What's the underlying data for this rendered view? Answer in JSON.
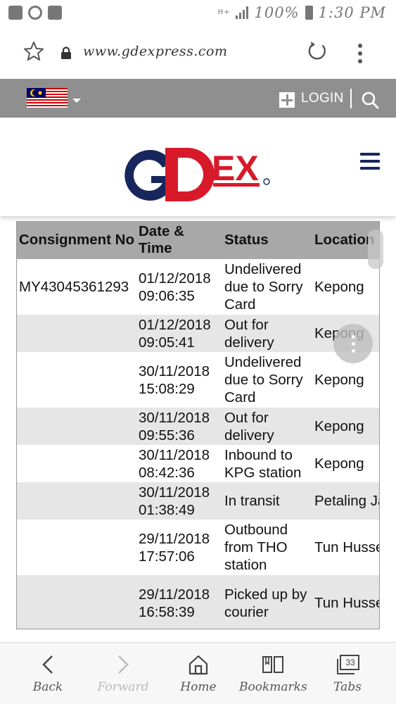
{
  "status_bar": {
    "network": "H+",
    "battery": "100%",
    "time": "1:30 PM"
  },
  "browser": {
    "url": "www.gdexpress.com"
  },
  "site_nav": {
    "login_label": "LOGIN"
  },
  "table": {
    "headers": [
      "Consignment No",
      "Date & Time",
      "Status",
      "Location"
    ],
    "rows": [
      {
        "consignment": "MY43045361293",
        "datetime": "01/12/2018 09:06:35",
        "status": "Undelivered due to Sorry Card",
        "location": "Kepong"
      },
      {
        "consignment": "",
        "datetime": "01/12/2018 09:05:41",
        "status": "Out for delivery",
        "location": "Kepong"
      },
      {
        "consignment": "",
        "datetime": "30/11/2018 15:08:29",
        "status": "Undelivered due to Sorry Card",
        "location": "Kepong"
      },
      {
        "consignment": "",
        "datetime": "30/11/2018 09:55:36",
        "status": "Out for delivery",
        "location": "Kepong"
      },
      {
        "consignment": "",
        "datetime": "30/11/2018 08:42:36",
        "status": "Inbound to KPG station",
        "location": "Kepong"
      },
      {
        "consignment": "",
        "datetime": "30/11/2018 01:38:49",
        "status": "In transit",
        "location": "Petaling Jaya"
      },
      {
        "consignment": "",
        "datetime": "29/11/2018 17:57:06",
        "status": "Outbound from THO station",
        "location": "Tun Hussein Onn"
      },
      {
        "consignment": "",
        "datetime": "29/11/2018 16:58:39",
        "status": "Picked up by courier",
        "location": "Tun Hussein Onn"
      }
    ]
  },
  "bottom_nav": {
    "back": "Back",
    "forward": "Forward",
    "home": "Home",
    "bookmarks": "Bookmarks",
    "tabs": "Tabs",
    "tabs_count": "33"
  },
  "colors": {
    "brand_navy": "#17265c",
    "brand_red": "#d8192a",
    "nav_gray": "#8f8f8f",
    "header_gray": "#a8a8a8",
    "row_alt": "#e6e6e6"
  }
}
